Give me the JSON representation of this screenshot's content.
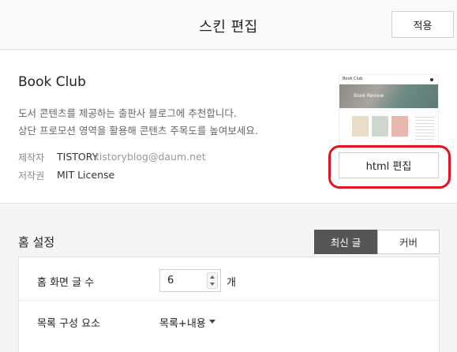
{
  "header": {
    "title": "스킨 편집",
    "apply_label": "적용"
  },
  "skin": {
    "name": "Book Club",
    "description_line1": "도서 콘텐츠를 제공하는 출판사 블로그에 추천합니다.",
    "description_line2": "상단 프로모션 영역을 활용해 콘텐츠 주목도를 높여보세요.",
    "maker_label": "제작자",
    "maker_value": "TISTORY",
    "maker_email": "tistoryblog@daum.net",
    "copyright_label": "저작권",
    "copyright_value": "MIT License",
    "html_edit_label": "html 편집",
    "thumbnail": {
      "title": "Book Club",
      "banner_text": "Book Review"
    }
  },
  "home_settings": {
    "title": "홈 설정",
    "tabs": [
      {
        "label": "최신 글",
        "active": true
      },
      {
        "label": "커버",
        "active": false
      }
    ],
    "post_count_label": "홈 화면 글 수",
    "post_count_value": "6",
    "post_count_unit": "개",
    "list_layout_label": "목록 구성 요소",
    "list_layout_value": "목록+내용"
  },
  "colors": {
    "highlight": "#e0141e",
    "active_tab_bg": "#555555"
  }
}
